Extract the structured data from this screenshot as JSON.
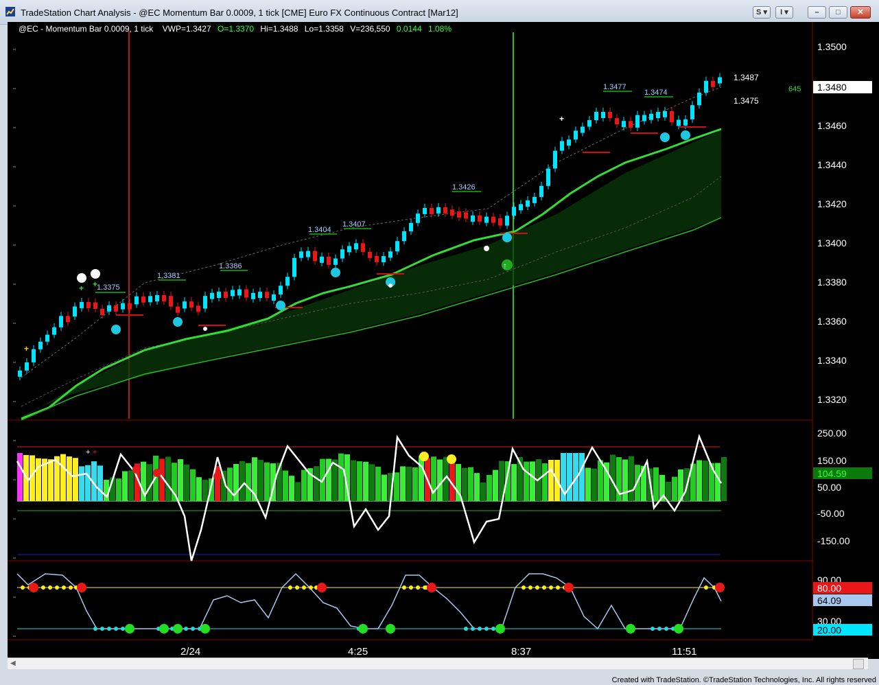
{
  "window": {
    "title": "TradeStation Chart Analysis - @EC Momentum Bar 0.0009, 1 tick [CME] Euro FX Continuous Contract [Mar12]",
    "btn_s": "S",
    "btn_i": "I",
    "min_glyph": "–",
    "max_glyph": "□",
    "close_glyph": "✕"
  },
  "header": {
    "symbol": "@EC - Momentum Bar 0.0009, 1 tick",
    "vwp": "VWP=1.3427",
    "open": "O=1.3370",
    "high": "Hi=1.3488",
    "low": "Lo=1.3358",
    "volume": "V=236,550",
    "change": "0.0144",
    "change_pct": "1.08%"
  },
  "price_panel": {
    "y_ticks": [
      "1.3500",
      "1.3480",
      "1.3460",
      "1.3440",
      "1.3420",
      "1.3400",
      "1.3380",
      "1.3360",
      "1.3340",
      "1.3320"
    ],
    "last_price": "1.3480",
    "label_high": "1.3487",
    "label_low": "1.3475",
    "countdown": "645",
    "swing_labels": [
      "1.3375",
      "1.3381",
      "1.3386",
      "1.3404",
      "1.3407",
      "1.3426",
      "1.3477",
      "1.3474"
    ]
  },
  "momentum_panel": {
    "y_ticks": [
      "250.00",
      "150.00",
      "50.00",
      "-50.00",
      "-150.00"
    ],
    "value_badge": "104.59"
  },
  "stoch_panel": {
    "y_ticks": [
      "90.00",
      "30.00"
    ],
    "badge_80": "80.00",
    "badge_value": "64.09",
    "badge_20": "20.00"
  },
  "x_axis": {
    "labels": [
      "2/24",
      "4:25",
      "8:37",
      "11:51"
    ]
  },
  "footer": {
    "text": "Created with TradeStation. ©TradeStation Technologies, Inc. All rights reserved"
  },
  "colors": {
    "up_bar": "#00e5ff",
    "down_bar": "#e81818",
    "ma": "#33dd33",
    "background": "#000000"
  }
}
